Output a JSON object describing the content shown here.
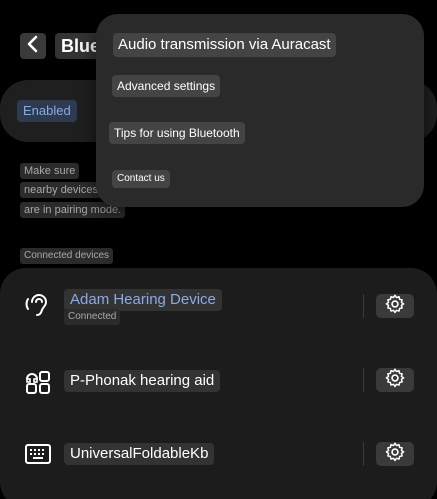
{
  "header": {
    "title": "Blue",
    "back_icon": "back-arrow-icon"
  },
  "status": {
    "enabled_label": "Enabled"
  },
  "hint_lines": [
    "Make sure",
    "nearby devices",
    "are in pairing mode."
  ],
  "connected_section": {
    "title": "Connected devices",
    "devices": [
      {
        "name": "Adam Hearing Device",
        "status": "Connected",
        "icon": "hearing-aid-icon",
        "settings_icon": "gear-icon",
        "active": true
      },
      {
        "name": "P-Phonak hearing aid",
        "status": "",
        "icon": "devices-grid-icon",
        "settings_icon": "gear-icon",
        "active": false
      },
      {
        "name": "UniversalFoldableKb",
        "status": "",
        "icon": "keyboard-icon",
        "settings_icon": "gear-icon",
        "active": false
      }
    ]
  },
  "menu": {
    "items": [
      "Audio transmission via Auracast",
      "Advanced settings",
      "Tips for using Bluetooth",
      "Contact us"
    ]
  },
  "colors": {
    "background": "#000000",
    "card": "#1c1c1c",
    "menu": "#2a2a2a",
    "accent": "#8aaae6"
  }
}
